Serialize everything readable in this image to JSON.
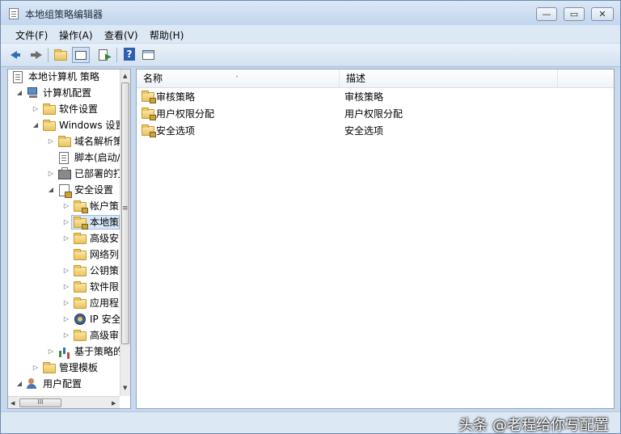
{
  "window": {
    "title": "本地组策略编辑器",
    "controls": {
      "minimize": "—",
      "maximize": "▭",
      "close": "✕"
    }
  },
  "menu": [
    "文件(F)",
    "操作(A)",
    "查看(V)",
    "帮助(H)"
  ],
  "toolbar": {
    "buttons": [
      "back-arrow-icon",
      "forward-arrow-icon",
      "up-folder-icon",
      "show-hide-tree-icon",
      "export-list-icon",
      "help-icon",
      "properties-icon"
    ],
    "help_glyph": "?"
  },
  "tree": {
    "items": [
      {
        "label": "本地计算机 策略",
        "icon": "policy-doc-icon",
        "expander": ""
      },
      {
        "label": "计算机配置",
        "icon": "computer-icon",
        "expander": "◢"
      },
      {
        "label": "软件设置",
        "icon": "folder-icon",
        "expander": "▷"
      },
      {
        "label": "Windows 设置",
        "icon": "folder-icon",
        "expander": "◢"
      },
      {
        "label": "域名解析策",
        "icon": "folder-icon",
        "expander": "▷"
      },
      {
        "label": "脚本(启动/",
        "icon": "script-icon",
        "expander": ""
      },
      {
        "label": "已部署的打",
        "icon": "printer-icon",
        "expander": "▷"
      },
      {
        "label": "安全设置",
        "icon": "security-settings-icon",
        "expander": "◢"
      },
      {
        "label": "帐户策",
        "icon": "folder-lock-icon",
        "expander": "▷"
      },
      {
        "label": "本地策",
        "icon": "folder-lock-icon",
        "expander": "▷",
        "selected": true
      },
      {
        "label": "高级安",
        "icon": "folder-icon",
        "expander": "▷"
      },
      {
        "label": "网络列",
        "icon": "folder-icon",
        "expander": ""
      },
      {
        "label": "公钥策",
        "icon": "folder-icon",
        "expander": "▷"
      },
      {
        "label": "软件限",
        "icon": "folder-icon",
        "expander": "▷"
      },
      {
        "label": "应用程",
        "icon": "folder-icon",
        "expander": "▷"
      },
      {
        "label": "IP 安全",
        "icon": "ip-security-icon",
        "expander": "▷"
      },
      {
        "label": "高级审",
        "icon": "folder-icon",
        "expander": "▷"
      },
      {
        "label": "基于策略的",
        "icon": "bar-chart-icon",
        "expander": "▷"
      },
      {
        "label": "管理模板",
        "icon": "folder-icon",
        "expander": "▷"
      },
      {
        "label": "用户配置",
        "icon": "users-icon",
        "expander": "◢"
      }
    ],
    "hscroll_thumb": "III",
    "vscroll_grip": "≡",
    "arrows": {
      "up": "▲",
      "down": "▼",
      "left": "◀",
      "right": "▶"
    }
  },
  "list": {
    "columns": [
      "名称",
      "描述"
    ],
    "sort_indicator": "˄",
    "rows": [
      {
        "name": "审核策略",
        "desc": "审核策略"
      },
      {
        "name": "用户权限分配",
        "desc": "用户权限分配"
      },
      {
        "name": "安全选项",
        "desc": "安全选项"
      }
    ]
  },
  "watermark": "头条 @老程给你写配置"
}
